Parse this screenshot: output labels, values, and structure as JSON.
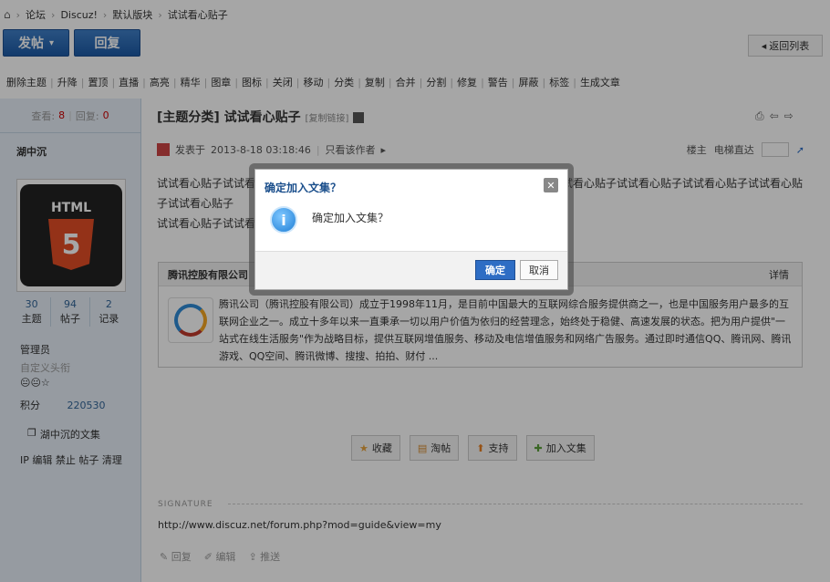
{
  "breadcrumb": {
    "home_icon": "home-icon",
    "items": [
      "论坛",
      "Discuz!",
      "默认版块",
      "试试看心贴子"
    ],
    "sep": "›"
  },
  "toolbar": {
    "post_label": "发帖",
    "post_arrow": "▾",
    "reply_label": "回复",
    "back_label": "返回列表",
    "back_arrow": "◂"
  },
  "mod_actions": [
    "删除主题",
    "升降",
    "置顶",
    "直播",
    "高亮",
    "精华",
    "图章",
    "图标",
    "关闭",
    "移动",
    "分类",
    "复制",
    "合并",
    "分割",
    "修复",
    "警告",
    "屏蔽",
    "标签",
    "生成文章"
  ],
  "sidebar": {
    "views_label": "查看:",
    "views": "8",
    "replies_label": "回复:",
    "replies": "0",
    "author": "湖中沉",
    "avatar_text": "HTML",
    "avatar_num": "5",
    "stats": [
      {
        "value": "30",
        "label": "主题"
      },
      {
        "value": "94",
        "label": "帖子"
      },
      {
        "value": "2",
        "label": "记录"
      }
    ],
    "group": "管理员",
    "custom_title": "自定义头衔",
    "medals": "😐😐☆",
    "points_label": "积分",
    "points": "220530",
    "collection": "湖中沉的文集",
    "ip_links": "IP 编辑 禁止 帖子 清理"
  },
  "post": {
    "category": "[主题分类]",
    "title": "试试看心贴子",
    "copy_link": "[复制链接]",
    "author_prefix": "发表于",
    "date": "2013-8-18 03:18:46",
    "only_author": "只看该作者",
    "only_author_arrow": "▸",
    "floor": "楼主",
    "jump_label": "电梯直达",
    "content_line1": "试试看心贴子试试看心贴子试试看心贴子试试看心贴子试试看心贴子试试看心贴子试试看心贴子试试看心贴子试试看心贴子试试看心贴子试试看心贴子",
    "content_line2": "试试看心贴子试试看心贴子试试看心贴子试试看心贴子"
  },
  "ad": {
    "company": "腾讯控股有限公司",
    "detail": "详情",
    "text": "腾讯公司（腾讯控股有限公司）成立于1998年11月，是目前中国最大的互联网综合服务提供商之一，也是中国服务用户最多的互联网企业之一。成立十多年以来一直秉承一切以用户价值为依归的经营理念，始终处于稳健、高速发展的状态。把为用户提供\"一站式在线生活服务\"作为战略目标，提供互联网增值服务、移动及电信增值服务和网络广告服务。通过即时通信QQ、腾讯网、腾讯游戏、QQ空间、腾讯微博、搜搜、拍拍、财付 ..."
  },
  "actions": [
    "收藏",
    "淘帖",
    "支持",
    "加入文集"
  ],
  "signature": {
    "label": "SIGNATURE",
    "url": "http://www.discuz.net/forum.php?mod=guide&view=my"
  },
  "bottom_links": [
    "回复",
    "编辑",
    "推送"
  ],
  "dialog": {
    "title": "确定加入文集？",
    "message": "确定加入文集？",
    "ok": "确定",
    "cancel": "取消",
    "close": "✕",
    "icon": "i"
  }
}
